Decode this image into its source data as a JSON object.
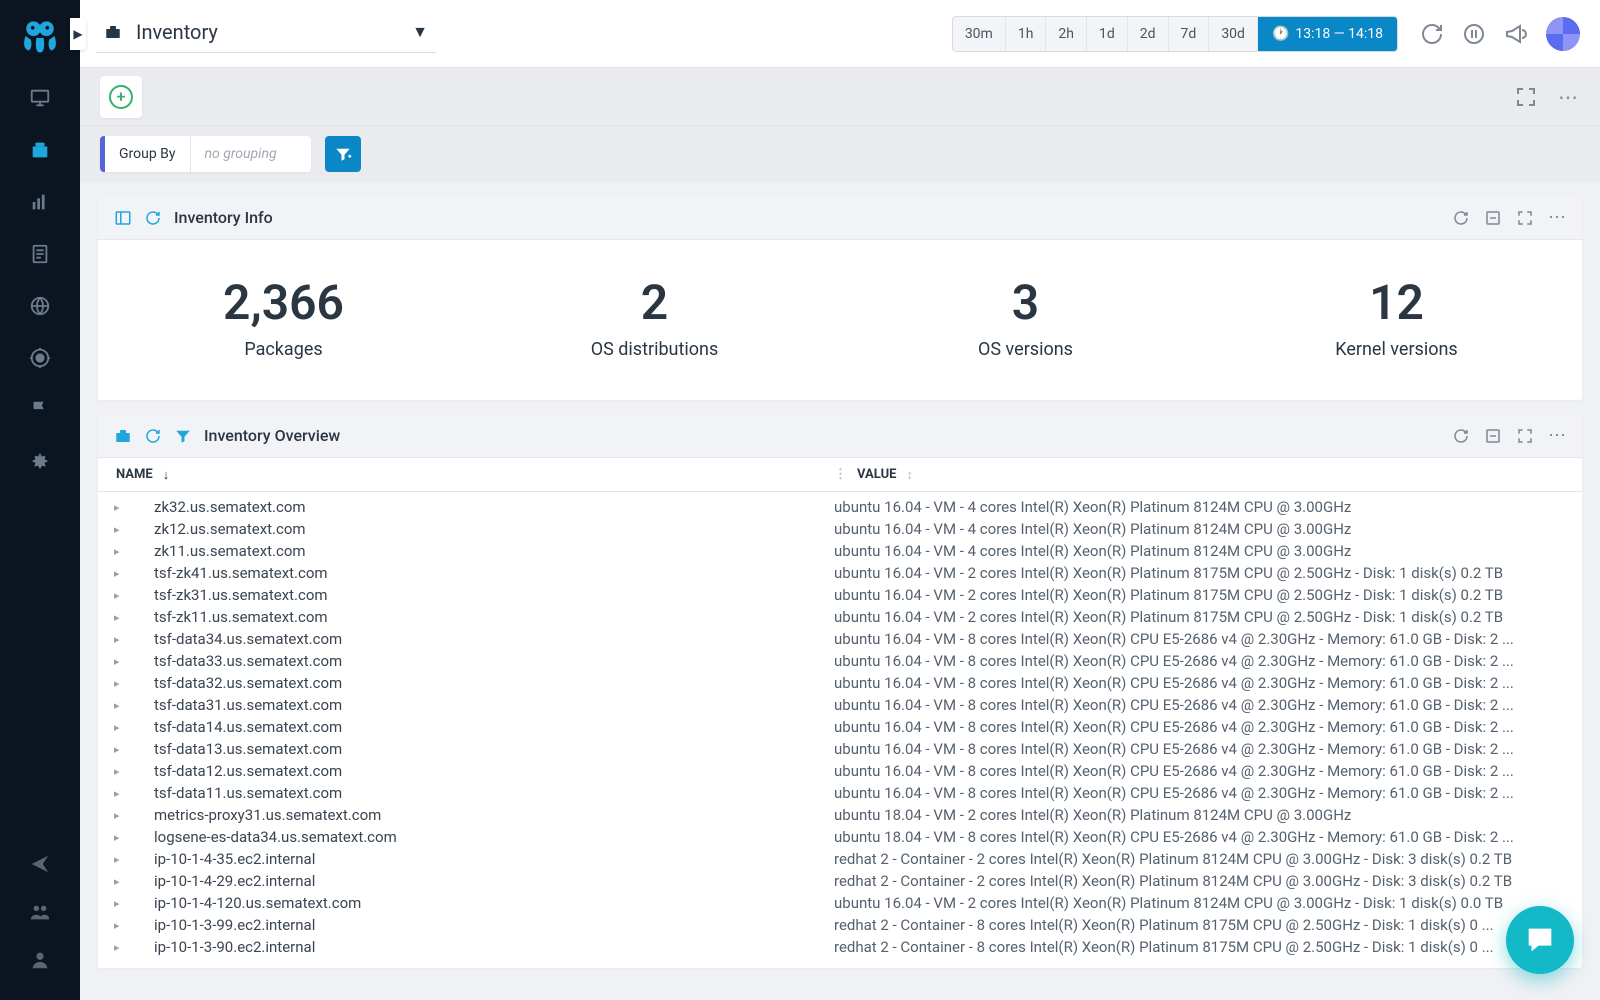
{
  "dash": {
    "title": "Inventory"
  },
  "time": {
    "segments": [
      "30m",
      "1h",
      "2h",
      "1d",
      "2d",
      "7d",
      "30d"
    ],
    "range": "13:18 — 14:18"
  },
  "groupby": {
    "label": "Group By",
    "value": "no grouping"
  },
  "info": {
    "title": "Inventory Info",
    "stats": [
      {
        "value": "2,366",
        "label": "Packages"
      },
      {
        "value": "2",
        "label": "OS distributions"
      },
      {
        "value": "3",
        "label": "OS versions"
      },
      {
        "value": "12",
        "label": "Kernel versions"
      }
    ]
  },
  "overview": {
    "title": "Inventory Overview",
    "cols": {
      "name": "NAME",
      "value": "VALUE"
    },
    "rows": [
      {
        "name": "zk32.us.sematext.com",
        "value": "ubuntu 16.04 - VM - 4 cores Intel(R) Xeon(R) Platinum 8124M CPU @ 3.00GHz"
      },
      {
        "name": "zk12.us.sematext.com",
        "value": "ubuntu 16.04 - VM - 4 cores Intel(R) Xeon(R) Platinum 8124M CPU @ 3.00GHz"
      },
      {
        "name": "zk11.us.sematext.com",
        "value": "ubuntu 16.04 - VM - 4 cores Intel(R) Xeon(R) Platinum 8124M CPU @ 3.00GHz"
      },
      {
        "name": "tsf-zk41.us.sematext.com",
        "value": "ubuntu 16.04 - VM - 2 cores Intel(R) Xeon(R) Platinum 8175M CPU @ 2.50GHz - Disk: 1 disk(s) 0.2 TB"
      },
      {
        "name": "tsf-zk31.us.sematext.com",
        "value": "ubuntu 16.04 - VM - 2 cores Intel(R) Xeon(R) Platinum 8175M CPU @ 2.50GHz - Disk: 1 disk(s) 0.2 TB"
      },
      {
        "name": "tsf-zk11.us.sematext.com",
        "value": "ubuntu 16.04 - VM - 2 cores Intel(R) Xeon(R) Platinum 8175M CPU @ 2.50GHz - Disk: 1 disk(s) 0.2 TB"
      },
      {
        "name": "tsf-data34.us.sematext.com",
        "value": "ubuntu 16.04 - VM - 8 cores Intel(R) Xeon(R) CPU E5-2686 v4 @ 2.30GHz - Memory: 61.0 GB - Disk: 2 ..."
      },
      {
        "name": "tsf-data33.us.sematext.com",
        "value": "ubuntu 16.04 - VM - 8 cores Intel(R) Xeon(R) CPU E5-2686 v4 @ 2.30GHz - Memory: 61.0 GB - Disk: 2 ..."
      },
      {
        "name": "tsf-data32.us.sematext.com",
        "value": "ubuntu 16.04 - VM - 8 cores Intel(R) Xeon(R) CPU E5-2686 v4 @ 2.30GHz - Memory: 61.0 GB - Disk: 2 ..."
      },
      {
        "name": "tsf-data31.us.sematext.com",
        "value": "ubuntu 16.04 - VM - 8 cores Intel(R) Xeon(R) CPU E5-2686 v4 @ 2.30GHz - Memory: 61.0 GB - Disk: 2 ..."
      },
      {
        "name": "tsf-data14.us.sematext.com",
        "value": "ubuntu 16.04 - VM - 8 cores Intel(R) Xeon(R) CPU E5-2686 v4 @ 2.30GHz - Memory: 61.0 GB - Disk: 2 ..."
      },
      {
        "name": "tsf-data13.us.sematext.com",
        "value": "ubuntu 16.04 - VM - 8 cores Intel(R) Xeon(R) CPU E5-2686 v4 @ 2.30GHz - Memory: 61.0 GB - Disk: 2 ..."
      },
      {
        "name": "tsf-data12.us.sematext.com",
        "value": "ubuntu 16.04 - VM - 8 cores Intel(R) Xeon(R) CPU E5-2686 v4 @ 2.30GHz - Memory: 61.0 GB - Disk: 2 ..."
      },
      {
        "name": "tsf-data11.us.sematext.com",
        "value": "ubuntu 16.04 - VM - 8 cores Intel(R) Xeon(R) CPU E5-2686 v4 @ 2.30GHz - Memory: 61.0 GB - Disk: 2 ..."
      },
      {
        "name": "metrics-proxy31.us.sematext.com",
        "value": "ubuntu 18.04 - VM - 2 cores Intel(R) Xeon(R) Platinum 8124M CPU @ 3.00GHz"
      },
      {
        "name": "logsene-es-data34.us.sematext.com",
        "value": "ubuntu 18.04 - VM - 8 cores Intel(R) Xeon(R) CPU E5-2686 v4 @ 2.30GHz - Memory: 61.0 GB - Disk: 2 ..."
      },
      {
        "name": "ip-10-1-4-35.ec2.internal",
        "value": "redhat 2 - Container - 2 cores Intel(R) Xeon(R) Platinum 8124M CPU @ 3.00GHz - Disk: 3 disk(s) 0.2 TB"
      },
      {
        "name": "ip-10-1-4-29.ec2.internal",
        "value": "redhat 2 - Container - 2 cores Intel(R) Xeon(R) Platinum 8124M CPU @ 3.00GHz - Disk: 3 disk(s) 0.2 TB"
      },
      {
        "name": "ip-10-1-4-120.us.sematext.com",
        "value": "ubuntu 16.04 - VM - 2 cores Intel(R) Xeon(R) Platinum 8124M CPU @ 3.00GHz - Disk: 1 disk(s) 0.0 TB"
      },
      {
        "name": "ip-10-1-3-99.ec2.internal",
        "value": "redhat 2 - Container - 8 cores Intel(R) Xeon(R) Platinum 8175M CPU @ 2.50GHz - Disk: 1 disk(s) 0 ..."
      },
      {
        "name": "ip-10-1-3-90.ec2.internal",
        "value": "redhat 2 - Container - 8 cores Intel(R) Xeon(R) Platinum 8175M CPU @ 2.50GHz - Disk: 1 disk(s) 0 ..."
      }
    ]
  }
}
